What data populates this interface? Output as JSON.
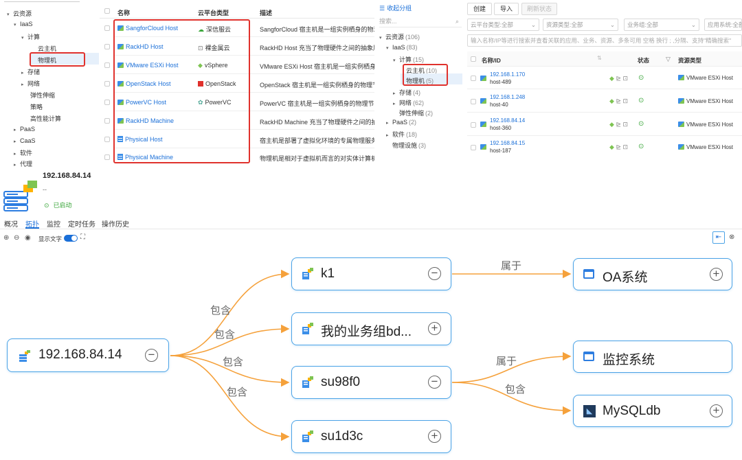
{
  "left_tree": {
    "items": [
      {
        "label": "云资源",
        "caret": "▾"
      },
      {
        "label": "IaaS",
        "caret": "▾"
      },
      {
        "label": "计算",
        "caret": "▾"
      },
      {
        "label": "云主机",
        "caret": ""
      },
      {
        "label": "物理机",
        "caret": ""
      },
      {
        "label": "存储",
        "caret": "▸"
      },
      {
        "label": "网络",
        "caret": "▸"
      },
      {
        "label": "弹性伸缩",
        "caret": ""
      },
      {
        "label": "策略",
        "caret": ""
      },
      {
        "label": "高性能计算",
        "caret": ""
      },
      {
        "label": "PaaS",
        "caret": "▸"
      },
      {
        "label": "CaaS",
        "caret": "▸"
      },
      {
        "label": "软件",
        "caret": "▸"
      },
      {
        "label": "代理",
        "caret": "▸"
      }
    ]
  },
  "type_table": {
    "headers": {
      "name": "名称",
      "platform": "云平台类型",
      "desc": "描述"
    },
    "rows": [
      {
        "name": "SangforCloud Host",
        "platform": "深信服云",
        "desc": "SangforCloud 宿主机是一组实例栖身的物理节点"
      },
      {
        "name": "RackHD Host",
        "platform": "裸金属云",
        "desc": "RackHD Host 充当了物理硬件之间的抽象层，"
      },
      {
        "name": "VMware ESXi Host",
        "platform": "vSphere",
        "desc": "VMware ESXi Host 宿主机是一组实例栖身的物"
      },
      {
        "name": "OpenStack Host",
        "platform": "OpenStack",
        "desc": "OpenStack 宿主机是一组实例栖身的物理节点，"
      },
      {
        "name": "PowerVC Host",
        "platform": "PowerVC",
        "desc": "PowerVC 宿主机是一组实例栖身的物理节点，"
      },
      {
        "name": "RackHD Machine",
        "platform": "",
        "desc": "RackHD Machine 充当了物理硬件之间的抽象层"
      },
      {
        "name": "Physical Host",
        "platform": "",
        "desc": "宿主机是部署了虚拟化环境的专属物理服务器，"
      },
      {
        "name": "Physical Machine",
        "platform": "",
        "desc": "物理机是相对于虚拟机而言的对实体计算机的称"
      }
    ]
  },
  "group_panel": {
    "collapse_label": "收起分组",
    "search_placeholder": "搜索...",
    "items": [
      {
        "label": "云资源",
        "count": "(106)",
        "caret": "▾"
      },
      {
        "label": "IaaS",
        "count": "(83)",
        "caret": "▾"
      },
      {
        "label": "计算",
        "count": "(15)",
        "caret": "▾"
      },
      {
        "label": "云主机",
        "count": "(10)",
        "caret": ""
      },
      {
        "label": "物理机",
        "count": "(5)",
        "caret": ""
      },
      {
        "label": "存储",
        "count": "(4)",
        "caret": "▸"
      },
      {
        "label": "网络",
        "count": "(62)",
        "caret": "▸"
      },
      {
        "label": "弹性伸缩",
        "count": "(2)",
        "caret": ""
      },
      {
        "label": "PaaS",
        "count": "(2)",
        "caret": "▸"
      },
      {
        "label": "软件",
        "count": "(18)",
        "caret": "▸"
      },
      {
        "label": "物理设施",
        "count": "(3)",
        "caret": ""
      }
    ]
  },
  "resource_list": {
    "buttons": {
      "create": "创建",
      "import": "导入",
      "refresh": "刷新状态"
    },
    "filters": [
      "云平台类型:全部",
      "资源类型:全部",
      "业务组:全部",
      "应用系统:全部"
    ],
    "search_placeholder": "输入名称/IP等进行搜索并查看关联的应用、业务、资源、多条可用 空格 换行 ; ,分隔、支持\"精确搜索\"",
    "headers": {
      "name": "名称/ID",
      "status": "状态",
      "type": "资源类型"
    },
    "rows": [
      {
        "ip": "192.168.1.170",
        "host": "host-489",
        "type": "VMware ESXi Host"
      },
      {
        "ip": "192.168.1.248",
        "host": "host-40",
        "type": "VMware ESXi Host"
      },
      {
        "ip": "192.168.84.14",
        "host": "host-360",
        "type": "VMware ESXi Host"
      },
      {
        "ip": "192.168.84.15",
        "host": "host-187",
        "type": "VMware ESXi Host"
      }
    ]
  },
  "detail": {
    "title": "192.168.84.14",
    "subtitle": "--",
    "status": "已启动",
    "tabs": [
      "概况",
      "拓扑",
      "监控",
      "定时任务",
      "操作历史"
    ],
    "active_tab": "拓扑",
    "show_text_label": "显示文字"
  },
  "topology": {
    "root": "192.168.84.14",
    "nodes": {
      "k1": "k1",
      "group": "我的业务组bd...",
      "su98": "su98f0",
      "su1d": "su1d3c",
      "oa": "OA系统",
      "monitor": "监控系统",
      "mysql": "MySQLdb"
    },
    "edge_labels": {
      "contains": "包含",
      "belongs": "属于"
    },
    "colors": {
      "edge": "#f5a13b",
      "node_border": "#4ba3e6",
      "accent": "#1a6fd8",
      "status": "#3aa63a",
      "highlight": "#e0312c"
    }
  }
}
